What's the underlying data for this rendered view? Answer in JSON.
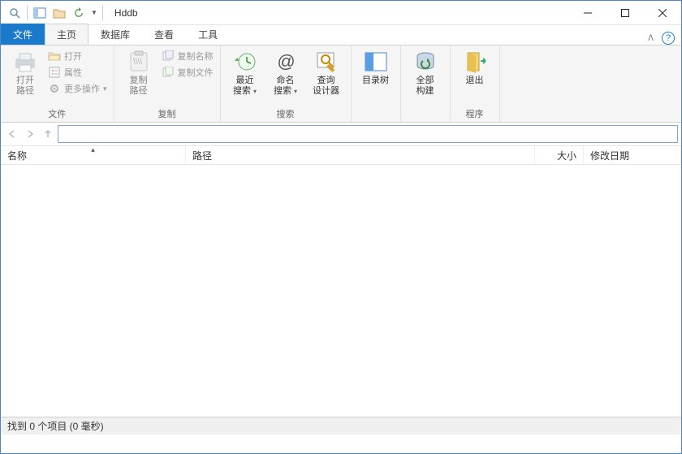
{
  "window": {
    "title": "Hddb"
  },
  "tabs": {
    "file": "文件",
    "home": "主页",
    "database": "数据库",
    "view": "查看",
    "tools": "工具"
  },
  "ribbon": {
    "file_group": {
      "open_path": "打开\n路径",
      "open": "打开",
      "properties": "属性",
      "more_actions": "更多操作",
      "label": "文件"
    },
    "copy_group": {
      "copy_path": "复制\n路径",
      "copy_name": "复制名称",
      "copy_file": "复制文件",
      "label": "复制"
    },
    "search_group": {
      "recent_search": "最近\n搜索",
      "named_search": "命名\n搜索",
      "query_designer": "查询\n设计器",
      "label": "搜索"
    },
    "dirtree": "目录树",
    "rebuild_all": "全部\n构建",
    "program_group": {
      "exit": "退出",
      "label": "程序"
    }
  },
  "columns": {
    "name": "名称",
    "path": "路径",
    "size": "大小",
    "date": "修改日期"
  },
  "search": {
    "value": ""
  },
  "status": "找到 0 个项目 (0 毫秒)"
}
